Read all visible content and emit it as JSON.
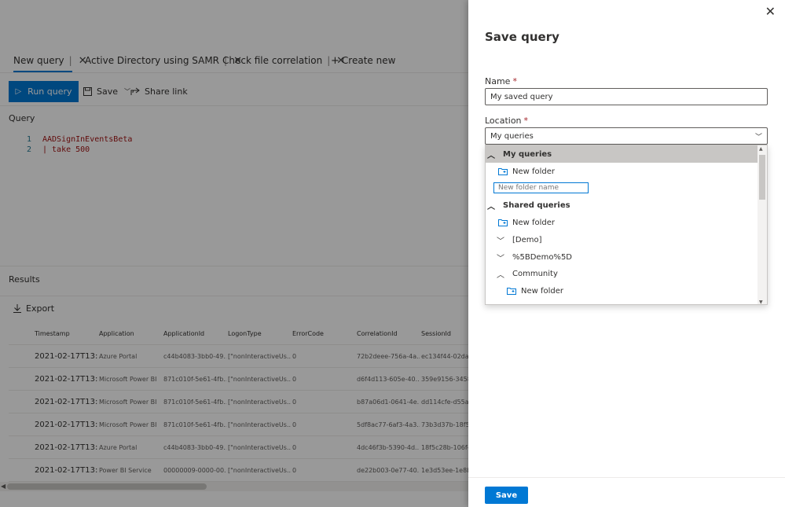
{
  "tabs": [
    {
      "label": "New query",
      "active": true
    },
    {
      "label": "Active Directory using SAMR",
      "active": false
    },
    {
      "label": "Check file correlation",
      "active": false
    }
  ],
  "create_new": "Create new",
  "toolbar": {
    "run_query": "Run query",
    "save": "Save",
    "share_link": "Share link"
  },
  "query_label": "Query",
  "code_lines": [
    {
      "n": "1",
      "text": "AADSignInEventsBeta"
    },
    {
      "n": "2",
      "text": "| take 500"
    }
  ],
  "results_label": "Results",
  "export_label": "Export",
  "grid": {
    "columns": [
      "Timestamp",
      "Application",
      "ApplicationId",
      "LogonType",
      "ErrorCode",
      "CorrelationId",
      "SessionId"
    ],
    "rows": [
      [
        "2021-02-17T13:5...",
        "Azure Portal",
        "c44b4083-3bb0-49...",
        "[\"nonInteractiveUs...",
        "0",
        "72b2deee-756a-4a...",
        "ec134f44-02da-4..."
      ],
      [
        "2021-02-17T13:5...",
        "Microsoft Power BI",
        "871c010f-5e61-4fb...",
        "[\"nonInteractiveUs...",
        "0",
        "d6f4d113-605e-40...",
        "359e9156-3458-..."
      ],
      [
        "2021-02-17T13:5...",
        "Microsoft Power BI",
        "871c010f-5e61-4fb...",
        "[\"nonInteractiveUs...",
        "0",
        "b87a06d1-0641-4e...",
        "dd114cfe-d55a-..."
      ],
      [
        "2021-02-17T13:5...",
        "Microsoft Power BI",
        "871c010f-5e61-4fb...",
        "[\"nonInteractiveUs...",
        "0",
        "5df8ac77-6af3-4a3...",
        "73b3d37b-18f5-..."
      ],
      [
        "2021-02-17T13:5...",
        "Azure Portal",
        "c44b4083-3bb0-49...",
        "[\"nonInteractiveUs...",
        "0",
        "4dc46f3b-5390-4d...",
        "18f5c28b-106f-4..."
      ],
      [
        "2021-02-17T13:5...",
        "Power BI Service",
        "00000009-0000-00...",
        "[\"nonInteractiveUs...",
        "0",
        "de22b003-0e77-40...",
        "1e3d53ee-1e8b-..."
      ]
    ]
  },
  "panel": {
    "title": "Save query",
    "name_label": "Name",
    "name_value": "My saved query",
    "location_label": "Location",
    "required_mark": "*",
    "location_value": "My queries",
    "dropdown": {
      "my_queries": "My queries",
      "new_folder_1": "New folder",
      "new_folder_placeholder": "New folder name",
      "shared_queries": "Shared queries",
      "new_folder_2": "New folder",
      "demo": "[Demo]",
      "demo_encoded": "%5BDemo%5D",
      "community": "Community",
      "new_folder_3": "New folder"
    },
    "save_button": "Save"
  },
  "colors": {
    "accent": "#0078d4",
    "overlay": "rgba(0,0,0,0.4)",
    "selected_item": "#c8c6c4"
  }
}
